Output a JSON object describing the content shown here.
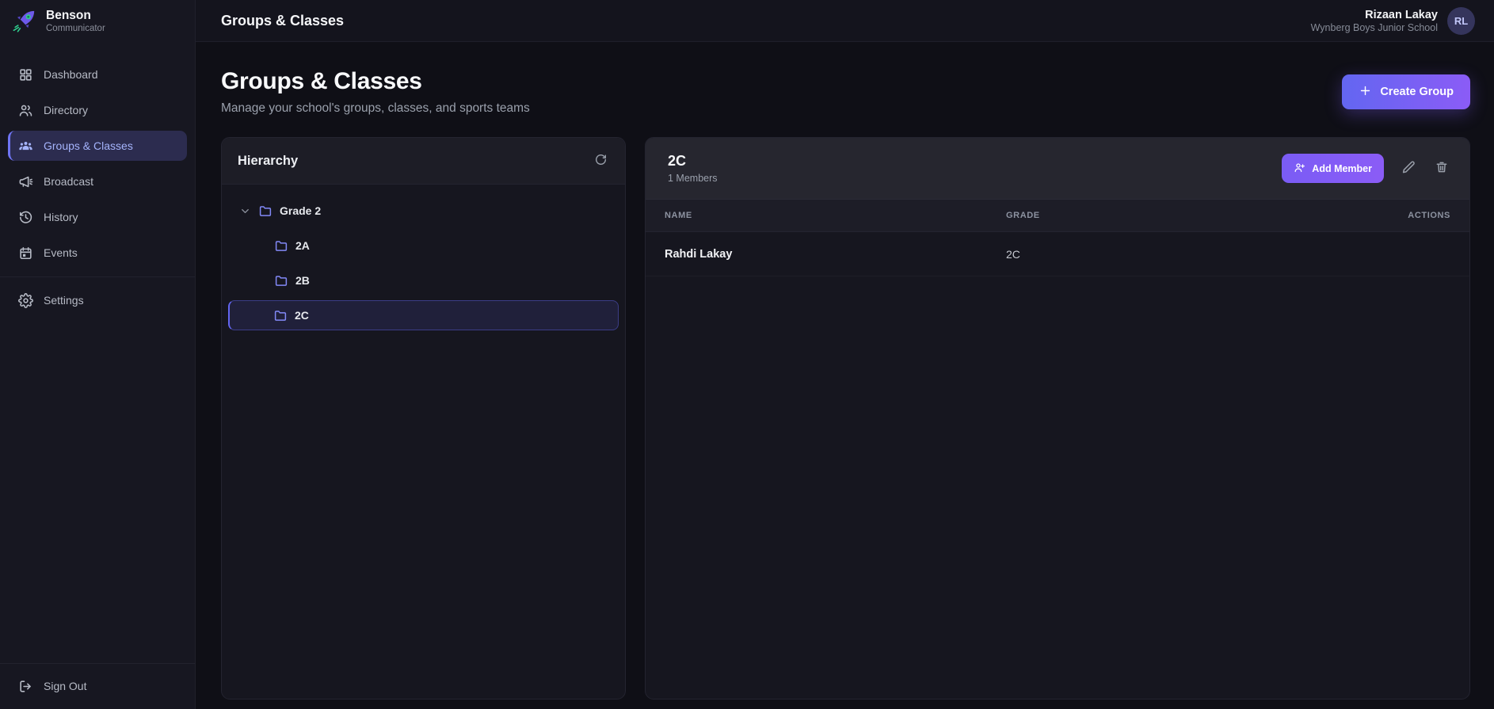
{
  "colors": {
    "accent": "#6366f1",
    "accent-light": "#a5b4fc",
    "violet": "#8b5cf6",
    "folder": "#8289f7",
    "green": "#2fd08f"
  },
  "brand": {
    "name": "Benson",
    "tagline": "Communicator",
    "logo_icon": "rocket-icon"
  },
  "topbar": {
    "title": "Groups & Classes"
  },
  "user": {
    "name": "Rizaan Lakay",
    "school": "Wynberg Boys Junior School",
    "initials": "RL"
  },
  "sidebar": {
    "main_items": [
      {
        "label": "Dashboard",
        "icon": "dashboard-icon",
        "active": false
      },
      {
        "label": "Directory",
        "icon": "directory-icon",
        "active": false
      },
      {
        "label": "Groups & Classes",
        "icon": "groups-icon",
        "active": true
      },
      {
        "label": "Broadcast",
        "icon": "broadcast-icon",
        "active": false
      },
      {
        "label": "History",
        "icon": "history-icon",
        "active": false
      },
      {
        "label": "Events",
        "icon": "events-icon",
        "active": false
      }
    ],
    "secondary_items": [
      {
        "label": "Settings",
        "icon": "settings-icon",
        "active": false
      }
    ],
    "sign_out_label": "Sign Out",
    "sign_out_icon": "sign-out-icon"
  },
  "page": {
    "title": "Groups & Classes",
    "subtitle": "Manage your school's groups, classes, and sports teams",
    "create_button": {
      "label": "Create Group",
      "icon": "plus-icon"
    }
  },
  "hierarchy": {
    "title": "Hierarchy",
    "refresh_icon": "refresh-icon",
    "tree": [
      {
        "label": "Grade 2",
        "level": 0,
        "expanded": true,
        "selected": false,
        "chevron": "chevron-down-icon",
        "icon": "folder-icon"
      },
      {
        "label": "2A",
        "level": 1,
        "expanded": false,
        "selected": false,
        "icon": "folder-icon"
      },
      {
        "label": "2B",
        "level": 1,
        "expanded": false,
        "selected": false,
        "icon": "folder-icon"
      },
      {
        "label": "2C",
        "level": 1,
        "expanded": false,
        "selected": true,
        "icon": "folder-icon"
      }
    ]
  },
  "group_detail": {
    "name": "2C",
    "members_count_label": "1 Members",
    "add_member_label": "Add Member",
    "add_member_icon": "user-plus-icon",
    "edit_icon": "edit-icon",
    "delete_icon": "trash-icon",
    "table": {
      "columns": [
        "NAME",
        "GRADE",
        "ACTIONS"
      ],
      "rows": [
        {
          "name": "Rahdi Lakay",
          "grade": "2C"
        }
      ]
    }
  }
}
